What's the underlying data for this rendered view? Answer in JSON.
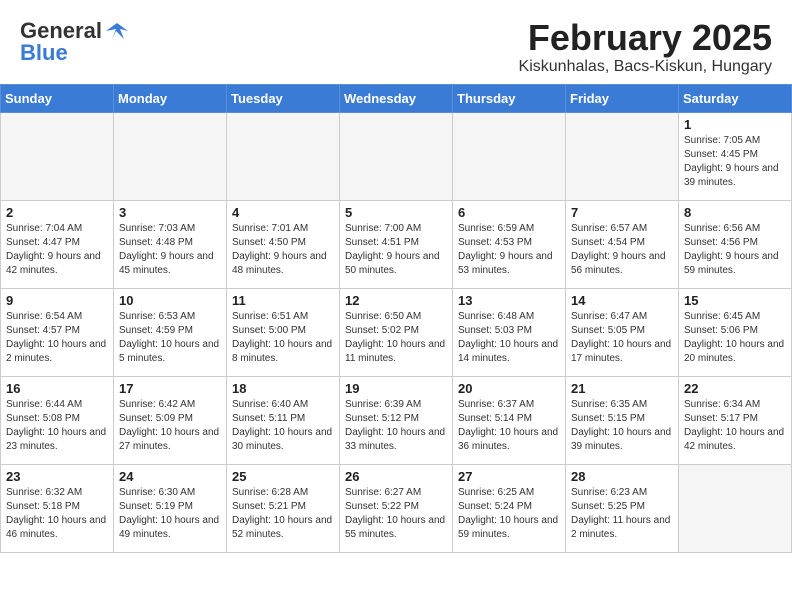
{
  "header": {
    "logo_general": "General",
    "logo_blue": "Blue",
    "month": "February 2025",
    "location": "Kiskunhalas, Bacs-Kiskun, Hungary"
  },
  "weekdays": [
    "Sunday",
    "Monday",
    "Tuesday",
    "Wednesday",
    "Thursday",
    "Friday",
    "Saturday"
  ],
  "weeks": [
    [
      {
        "day": "",
        "info": ""
      },
      {
        "day": "",
        "info": ""
      },
      {
        "day": "",
        "info": ""
      },
      {
        "day": "",
        "info": ""
      },
      {
        "day": "",
        "info": ""
      },
      {
        "day": "",
        "info": ""
      },
      {
        "day": "1",
        "info": "Sunrise: 7:05 AM\nSunset: 4:45 PM\nDaylight: 9 hours and 39 minutes."
      }
    ],
    [
      {
        "day": "2",
        "info": "Sunrise: 7:04 AM\nSunset: 4:47 PM\nDaylight: 9 hours and 42 minutes."
      },
      {
        "day": "3",
        "info": "Sunrise: 7:03 AM\nSunset: 4:48 PM\nDaylight: 9 hours and 45 minutes."
      },
      {
        "day": "4",
        "info": "Sunrise: 7:01 AM\nSunset: 4:50 PM\nDaylight: 9 hours and 48 minutes."
      },
      {
        "day": "5",
        "info": "Sunrise: 7:00 AM\nSunset: 4:51 PM\nDaylight: 9 hours and 50 minutes."
      },
      {
        "day": "6",
        "info": "Sunrise: 6:59 AM\nSunset: 4:53 PM\nDaylight: 9 hours and 53 minutes."
      },
      {
        "day": "7",
        "info": "Sunrise: 6:57 AM\nSunset: 4:54 PM\nDaylight: 9 hours and 56 minutes."
      },
      {
        "day": "8",
        "info": "Sunrise: 6:56 AM\nSunset: 4:56 PM\nDaylight: 9 hours and 59 minutes."
      }
    ],
    [
      {
        "day": "9",
        "info": "Sunrise: 6:54 AM\nSunset: 4:57 PM\nDaylight: 10 hours and 2 minutes."
      },
      {
        "day": "10",
        "info": "Sunrise: 6:53 AM\nSunset: 4:59 PM\nDaylight: 10 hours and 5 minutes."
      },
      {
        "day": "11",
        "info": "Sunrise: 6:51 AM\nSunset: 5:00 PM\nDaylight: 10 hours and 8 minutes."
      },
      {
        "day": "12",
        "info": "Sunrise: 6:50 AM\nSunset: 5:02 PM\nDaylight: 10 hours and 11 minutes."
      },
      {
        "day": "13",
        "info": "Sunrise: 6:48 AM\nSunset: 5:03 PM\nDaylight: 10 hours and 14 minutes."
      },
      {
        "day": "14",
        "info": "Sunrise: 6:47 AM\nSunset: 5:05 PM\nDaylight: 10 hours and 17 minutes."
      },
      {
        "day": "15",
        "info": "Sunrise: 6:45 AM\nSunset: 5:06 PM\nDaylight: 10 hours and 20 minutes."
      }
    ],
    [
      {
        "day": "16",
        "info": "Sunrise: 6:44 AM\nSunset: 5:08 PM\nDaylight: 10 hours and 23 minutes."
      },
      {
        "day": "17",
        "info": "Sunrise: 6:42 AM\nSunset: 5:09 PM\nDaylight: 10 hours and 27 minutes."
      },
      {
        "day": "18",
        "info": "Sunrise: 6:40 AM\nSunset: 5:11 PM\nDaylight: 10 hours and 30 minutes."
      },
      {
        "day": "19",
        "info": "Sunrise: 6:39 AM\nSunset: 5:12 PM\nDaylight: 10 hours and 33 minutes."
      },
      {
        "day": "20",
        "info": "Sunrise: 6:37 AM\nSunset: 5:14 PM\nDaylight: 10 hours and 36 minutes."
      },
      {
        "day": "21",
        "info": "Sunrise: 6:35 AM\nSunset: 5:15 PM\nDaylight: 10 hours and 39 minutes."
      },
      {
        "day": "22",
        "info": "Sunrise: 6:34 AM\nSunset: 5:17 PM\nDaylight: 10 hours and 42 minutes."
      }
    ],
    [
      {
        "day": "23",
        "info": "Sunrise: 6:32 AM\nSunset: 5:18 PM\nDaylight: 10 hours and 46 minutes."
      },
      {
        "day": "24",
        "info": "Sunrise: 6:30 AM\nSunset: 5:19 PM\nDaylight: 10 hours and 49 minutes."
      },
      {
        "day": "25",
        "info": "Sunrise: 6:28 AM\nSunset: 5:21 PM\nDaylight: 10 hours and 52 minutes."
      },
      {
        "day": "26",
        "info": "Sunrise: 6:27 AM\nSunset: 5:22 PM\nDaylight: 10 hours and 55 minutes."
      },
      {
        "day": "27",
        "info": "Sunrise: 6:25 AM\nSunset: 5:24 PM\nDaylight: 10 hours and 59 minutes."
      },
      {
        "day": "28",
        "info": "Sunrise: 6:23 AM\nSunset: 5:25 PM\nDaylight: 11 hours and 2 minutes."
      },
      {
        "day": "",
        "info": ""
      }
    ]
  ]
}
